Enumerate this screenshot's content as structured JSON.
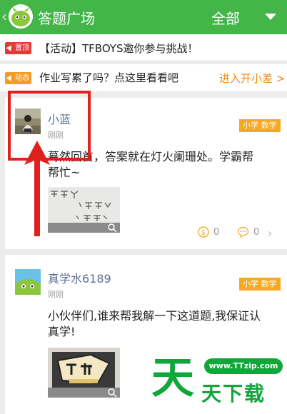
{
  "header": {
    "title": "答题广场",
    "filter_label": "全部"
  },
  "notices": [
    {
      "tag": "置顶",
      "tag_color": "#e23a36",
      "text": "【活动】TFBOYS邀你参与挑战！"
    },
    {
      "tag": "动态",
      "tag_color": "#f39c26",
      "text": "作业写累了吗？点这里看看吧",
      "link": "进入开小差 >"
    }
  ],
  "posts": [
    {
      "user": "小蓝",
      "time": "刚刚",
      "subject": "小学 数学",
      "question": "蓦然回首，答案就在灯火阑珊处。学霸帮帮忙~",
      "reward": "0",
      "comments": "0"
    },
    {
      "user": "真学水6189",
      "time": "刚刚",
      "subject": "小学 数学",
      "question": "小伙伴们,谁来帮我解一下这道题,我保证认真学!"
    }
  ],
  "watermark": {
    "url": "www.TTzip.com",
    "glyph": "天",
    "name": "天下载"
  },
  "colors": {
    "header_green": "#43b549",
    "subject_tag": "#f6a823",
    "username": "#5a6f93",
    "link_orange": "#f08a1a",
    "annotation_red": "#e0201d"
  }
}
